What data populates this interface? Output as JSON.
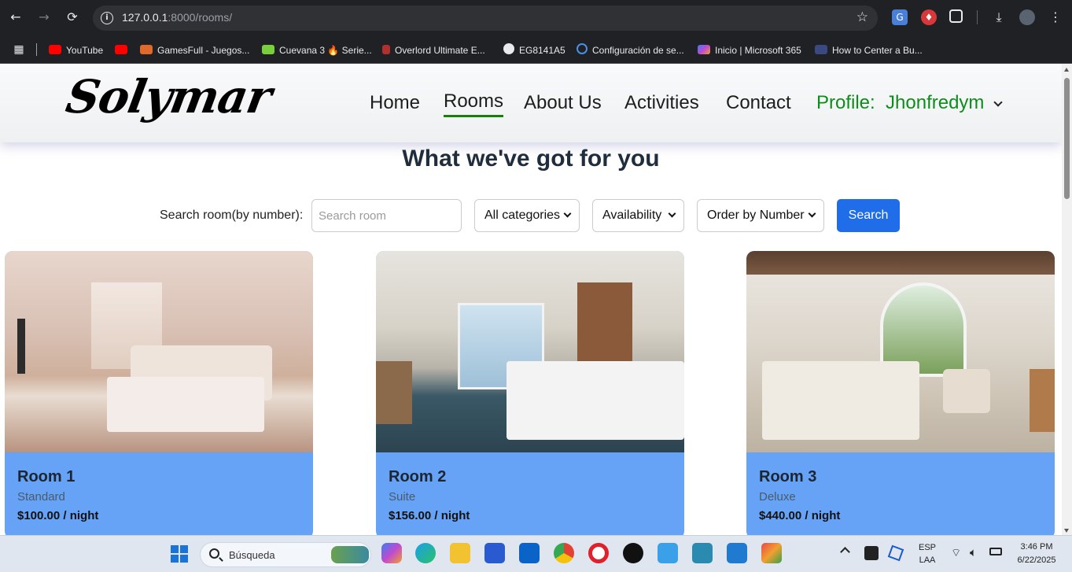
{
  "browser": {
    "url_host": "127.0.0.1",
    "url_rest": ":8000/rooms/",
    "bookmarks": [
      {
        "label": "YouTube",
        "color": "#ff0000"
      },
      {
        "label": "",
        "color": "#ff0000"
      },
      {
        "label": "GamesFull - Juegos...",
        "color": "#e06a2c"
      },
      {
        "label": "Cuevana 3 🔥 Serie...",
        "color": "#7ad03a"
      },
      {
        "label": "Overlord Ultimate E...",
        "color": "#b03030"
      },
      {
        "label": "EG8141A5",
        "color": "#e8eaed"
      },
      {
        "label": "Configuración de se...",
        "color": "#4a90e2"
      },
      {
        "label": "Inicio | Microsoft 365",
        "color": "#c04ad0"
      },
      {
        "label": "How to Center a Bu...",
        "color": "#3a4a80"
      }
    ]
  },
  "site": {
    "logo": "Solymar",
    "nav": {
      "home": "Home",
      "rooms": "Rooms",
      "about": "About Us",
      "activities": "Activities",
      "contact": "Contact",
      "profile": "Profile:  Jhonfredym"
    },
    "heading": "What we've got for you",
    "filters": {
      "search_label": "Search room(by number):",
      "search_placeholder": "Search room",
      "category": "All categories",
      "availability": "Availability",
      "order": "Order by Number",
      "search_button": "Search"
    },
    "rooms": [
      {
        "title": "Room 1",
        "category": "Standard",
        "price": "$100.00 / night"
      },
      {
        "title": "Room 2",
        "category": "Suite",
        "price": "$156.00 / night"
      },
      {
        "title": "Room 3",
        "category": "Deluxe",
        "price": "$440.00 / night"
      }
    ]
  },
  "taskbar": {
    "search_text": "Búsqueda",
    "lang_top": "ESP",
    "lang_bottom": "LAA",
    "time": "3:46 PM",
    "date": "6/22/2025"
  },
  "colors": {
    "accent": "#1f6de8",
    "card": "#66a3f7",
    "profile": "#0e8c1c",
    "active_underline": "#16800a"
  }
}
